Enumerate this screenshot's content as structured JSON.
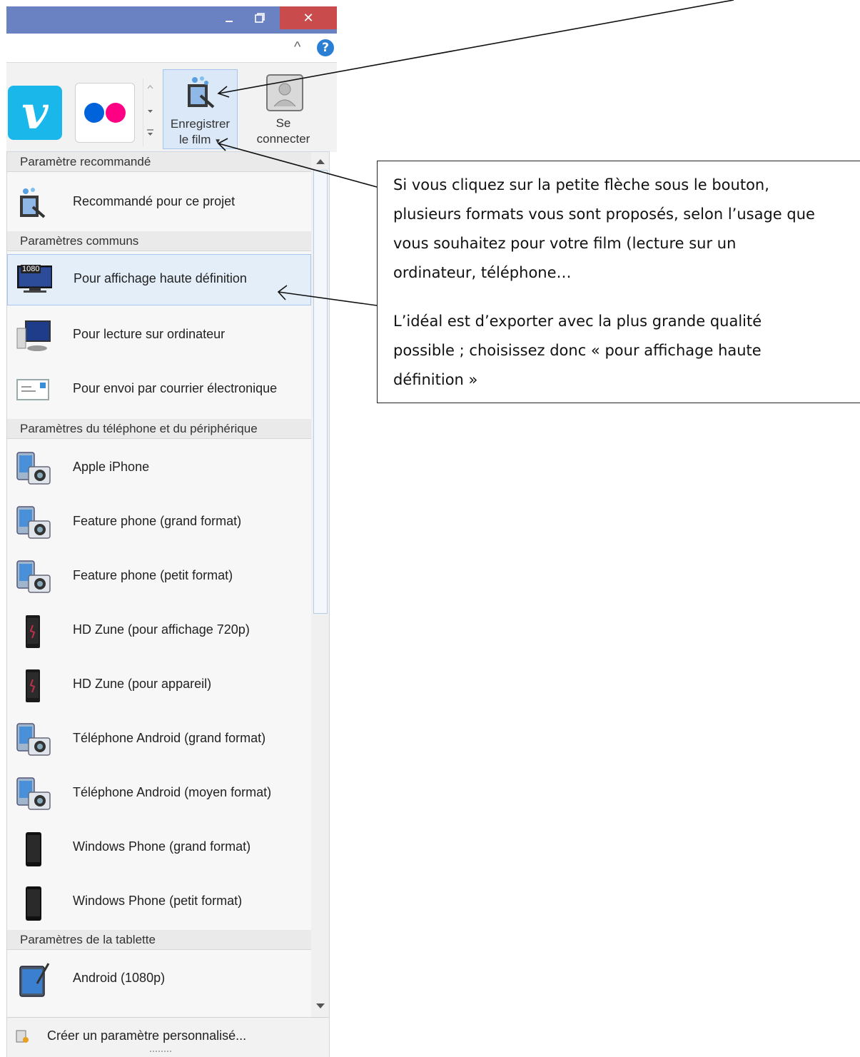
{
  "window": {
    "minimize_icon": "minimize-icon",
    "restore_icon": "restore-icon",
    "close_glyph": "✕"
  },
  "ribbon": {
    "collapse_glyph": "^",
    "help_glyph": "?",
    "vimeo_glyph": "v",
    "save_label_line1": "Enregistrer",
    "save_label_line2": "le film",
    "connect_label_line1": "Se",
    "connect_label_line2": "connecter"
  },
  "menu": {
    "sections": [
      {
        "title": "Paramètre recommandé"
      },
      {
        "title": "Paramètres communs"
      },
      {
        "title": "Paramètres du téléphone et du périphérique"
      },
      {
        "title": "Paramètres de la tablette"
      }
    ],
    "items": [
      {
        "label": "Recommandé pour ce projet",
        "icon": "film-settings-icon"
      },
      {
        "label": "Pour affichage haute définition",
        "icon": "hd-monitor-icon"
      },
      {
        "label": "Pour lecture sur ordinateur",
        "icon": "computer-icon"
      },
      {
        "label": "Pour envoi par courrier électronique",
        "icon": "email-icon"
      },
      {
        "label": "Apple iPhone",
        "icon": "phone-camera-icon"
      },
      {
        "label": "Feature phone (grand format)",
        "icon": "phone-camera-icon"
      },
      {
        "label": "Feature phone (petit format)",
        "icon": "phone-camera-icon"
      },
      {
        "label": "HD Zune (pour affichage 720p)",
        "icon": "zune-icon"
      },
      {
        "label": "HD Zune (pour appareil)",
        "icon": "zune-icon"
      },
      {
        "label": "Téléphone Android (grand format)",
        "icon": "phone-camera-icon"
      },
      {
        "label": "Téléphone Android (moyen format)",
        "icon": "phone-camera-icon"
      },
      {
        "label": "Windows Phone (grand format)",
        "icon": "windows-phone-icon"
      },
      {
        "label": "Windows Phone (petit format)",
        "icon": "windows-phone-icon"
      },
      {
        "label": "Android (1080p)",
        "icon": "tablet-icon"
      }
    ],
    "hd_badge": "1080",
    "footer_label": "Créer un paramètre personnalisé..."
  },
  "callout": {
    "paragraph1": "Si vous cliquez sur la petite flèche sous le bouton, plusieurs formats vous sont proposés, selon l’usage que vous souhaitez pour votre film (lecture sur un ordinateur, téléphone…",
    "paragraph2": "L’idéal est d’exporter avec la plus grande qualité possible ; choisissez donc « pour affichage haute définition »"
  },
  "colors": {
    "titlebar": "#6b82c2",
    "close": "#c94b4b",
    "vimeo": "#1ab7ea",
    "flickr_blue": "#0063dc",
    "flickr_pink": "#ff0084",
    "selection": "#e4eef9"
  }
}
